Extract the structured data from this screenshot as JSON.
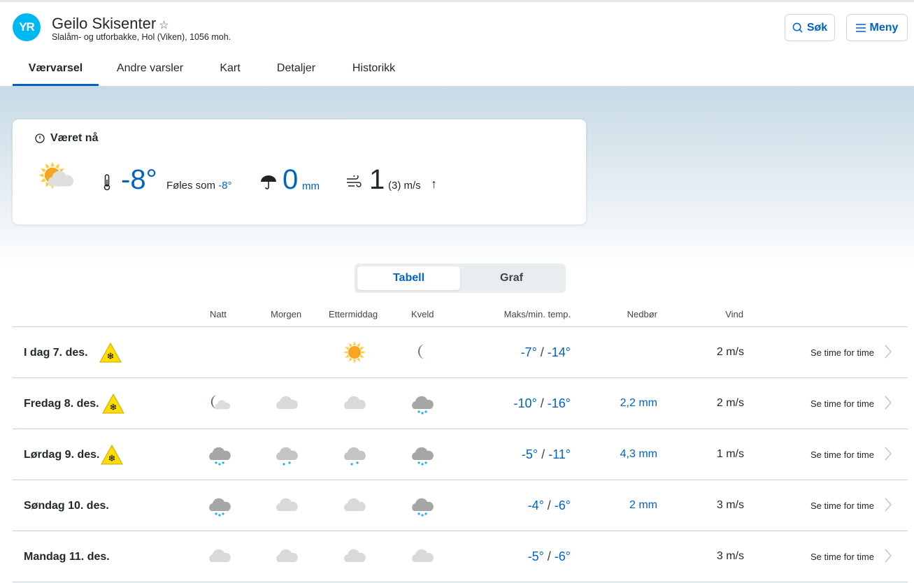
{
  "header": {
    "logo": "YR",
    "title": "Geilo Skisenter",
    "subtitle": "Slalåm- og utforbakke, Hol (Viken), 1056 moh.",
    "search_label": "Søk",
    "menu_label": "Meny"
  },
  "tabs": [
    {
      "label": "Værvarsel",
      "active": true
    },
    {
      "label": "Andre varsler"
    },
    {
      "label": "Kart"
    },
    {
      "label": "Detaljer"
    },
    {
      "label": "Historikk"
    }
  ],
  "now": {
    "heading": "Været nå",
    "icon": "partly-cloudy-day",
    "temp": "-8°",
    "feels_label": "Føles som",
    "feels_value": "-8°",
    "precip": "0",
    "precip_unit": "mm",
    "wind": "1",
    "gust": "(3)",
    "wind_unit": "m/s",
    "wind_arrow": "↑"
  },
  "view_toggle": {
    "table": "Tabell",
    "graph": "Graf"
  },
  "columns": {
    "night": "Natt",
    "morning": "Morgen",
    "afternoon": "Ettermiddag",
    "evening": "Kveld",
    "temp": "Maks/min. temp.",
    "precip": "Nedbør",
    "wind": "Vind"
  },
  "colors": {
    "accent": "#0062c3",
    "logo": "#00b8f1",
    "warning": "#ffdd00"
  },
  "rows": [
    {
      "day": "I dag 7. des.",
      "warning": true,
      "icons": [
        null,
        null,
        "sun",
        "moon"
      ],
      "max": "-7°",
      "min": "-14°",
      "precip": "",
      "wind": "2 m/s",
      "link": "Se time for time"
    },
    {
      "day": "Fredag 8. des.",
      "warning": true,
      "icons": [
        "partly-cloudy-night",
        "cloudy",
        "cloudy",
        "heavy-snow"
      ],
      "max": "-10°",
      "min": "-16°",
      "precip": "2,2 mm",
      "wind": "2 m/s",
      "link": "Se time for time"
    },
    {
      "day": "Lørdag 9. des.",
      "warning": true,
      "icons": [
        "heavy-snow",
        "light-snow",
        "light-snow",
        "heavy-snow"
      ],
      "max": "-5°",
      "min": "-11°",
      "precip": "4,3 mm",
      "wind": "1 m/s",
      "link": "Se time for time"
    },
    {
      "day": "Søndag 10. des.",
      "warning": false,
      "icons": [
        "heavy-snow",
        "cloudy",
        "cloudy",
        "heavy-snow"
      ],
      "max": "-4°",
      "min": "-6°",
      "precip": "2 mm",
      "wind": "3 m/s",
      "link": "Se time for time"
    },
    {
      "day": "Mandag 11. des.",
      "warning": false,
      "icons": [
        "cloudy",
        "cloudy",
        "cloudy",
        "cloudy"
      ],
      "max": "-5°",
      "min": "-6°",
      "precip": "",
      "wind": "3 m/s",
      "link": "Se time for time"
    }
  ]
}
